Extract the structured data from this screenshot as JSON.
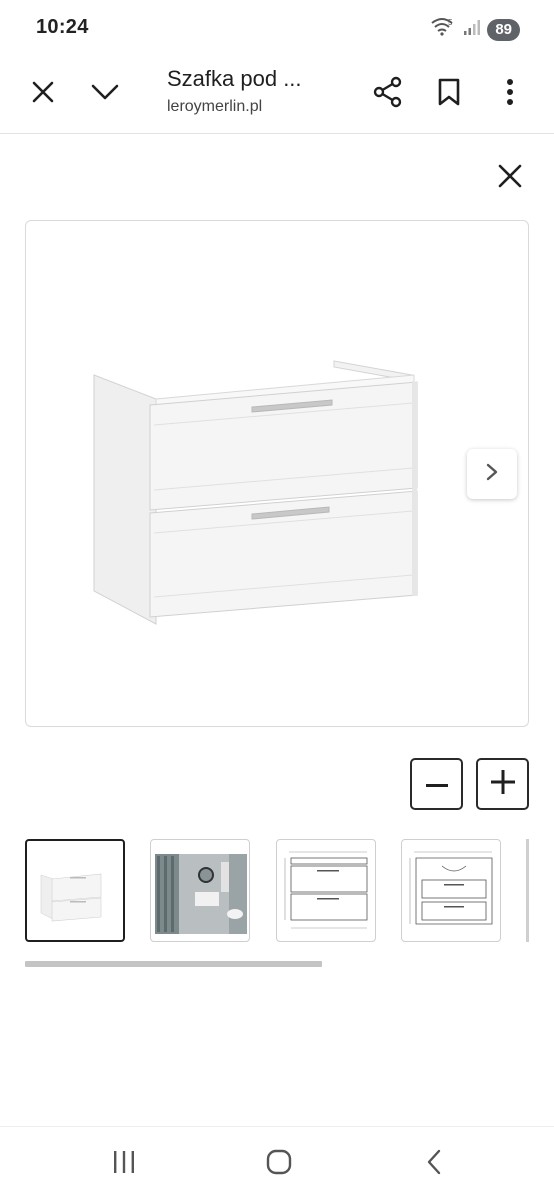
{
  "status_bar": {
    "time": "10:24",
    "battery": "89",
    "icons": [
      "wifi-icon",
      "signal-icon",
      "battery-icon"
    ]
  },
  "toolbar": {
    "title": "Szafka pod ...",
    "domain": "leroymerlin.pl",
    "icons": [
      "close-icon",
      "chevron-down-icon",
      "share-icon",
      "bookmark-icon",
      "more-vert-icon"
    ]
  },
  "viewer": {
    "close_icon": "close-icon",
    "next_icon": "chevron-right-icon",
    "zoom_out_icon": "minus-icon",
    "zoom_in_icon": "plus-icon",
    "thumbnails": [
      {
        "label": "cabinet-front-view",
        "selected": true
      },
      {
        "label": "bathroom-scene"
      },
      {
        "label": "dimension-drawing-front"
      },
      {
        "label": "dimension-drawing-open"
      }
    ],
    "thumbnail_scroll_fraction": 0.59
  },
  "nav_bar": {
    "icons": [
      "recent-apps-icon",
      "home-icon",
      "back-icon"
    ]
  },
  "colors": {
    "text": "#1f1f1f",
    "border": "#dadada",
    "selected_border": "#1f1f1f",
    "battery_badge": "#5f6368"
  }
}
